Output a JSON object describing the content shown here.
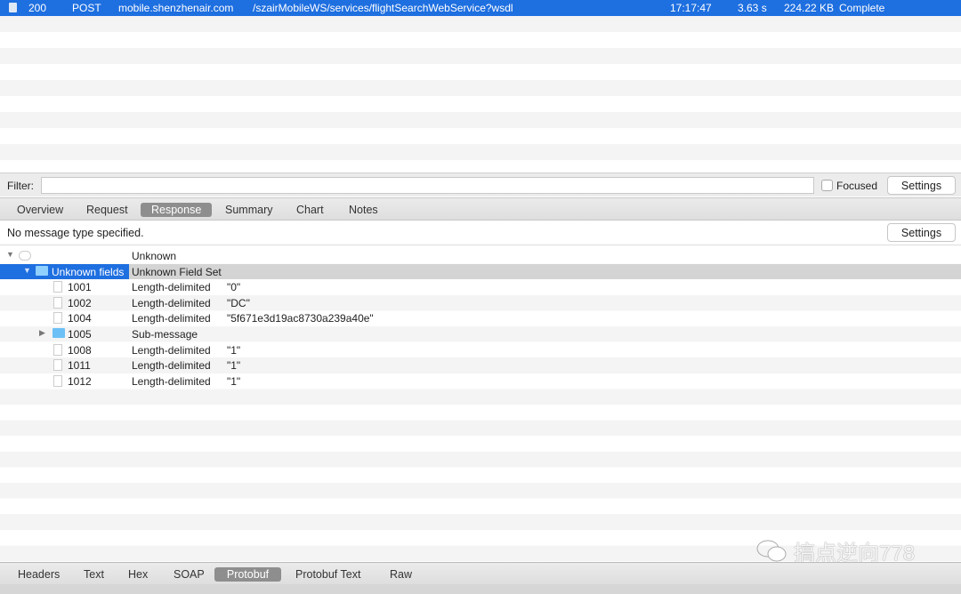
{
  "request": {
    "status": "200",
    "method": "POST",
    "host": "mobile.shenzhenair.com",
    "path": "/szairMobileWS/services/flightSearchWebService?wsdl",
    "time": "17:17:47",
    "duration": "3.63 s",
    "size": "224.22 KB",
    "state": "Complete"
  },
  "filter": {
    "label": "Filter:",
    "value": "",
    "focused_label": "Focused",
    "focused_checked": false,
    "settings_label": "Settings"
  },
  "tabs": [
    "Overview",
    "Request",
    "Response",
    "Summary",
    "Chart",
    "Notes"
  ],
  "active_tab": "Response",
  "message": {
    "text": "No message type specified.",
    "settings_label": "Settings"
  },
  "tree": {
    "root": {
      "type": "Unknown"
    },
    "set": {
      "name": "Unknown fields",
      "type": "Unknown Field Set"
    },
    "fields": [
      {
        "id": "1001",
        "type": "Length-delimited",
        "value": "\"0\""
      },
      {
        "id": "1002",
        "type": "Length-delimited",
        "value": "\"DC\""
      },
      {
        "id": "1004",
        "type": "Length-delimited",
        "value": "\"5f671e3d19ac8730a239a40e\""
      },
      {
        "id": "1005",
        "type": "Sub-message",
        "value": ""
      },
      {
        "id": "1008",
        "type": "Length-delimited",
        "value": "\"1\""
      },
      {
        "id": "1011",
        "type": "Length-delimited",
        "value": "\"1\""
      },
      {
        "id": "1012",
        "type": "Length-delimited",
        "value": "\"1\""
      }
    ]
  },
  "bottom_tabs": [
    "Headers",
    "Text",
    "Hex",
    "SOAP",
    "Protobuf",
    "Protobuf Text",
    "Raw"
  ],
  "active_bottom_tab": "Protobuf",
  "watermark": "搞点逆向778",
  "colors": {
    "selection": "#1e6fe0",
    "active_tab": "#8e8e8e"
  }
}
